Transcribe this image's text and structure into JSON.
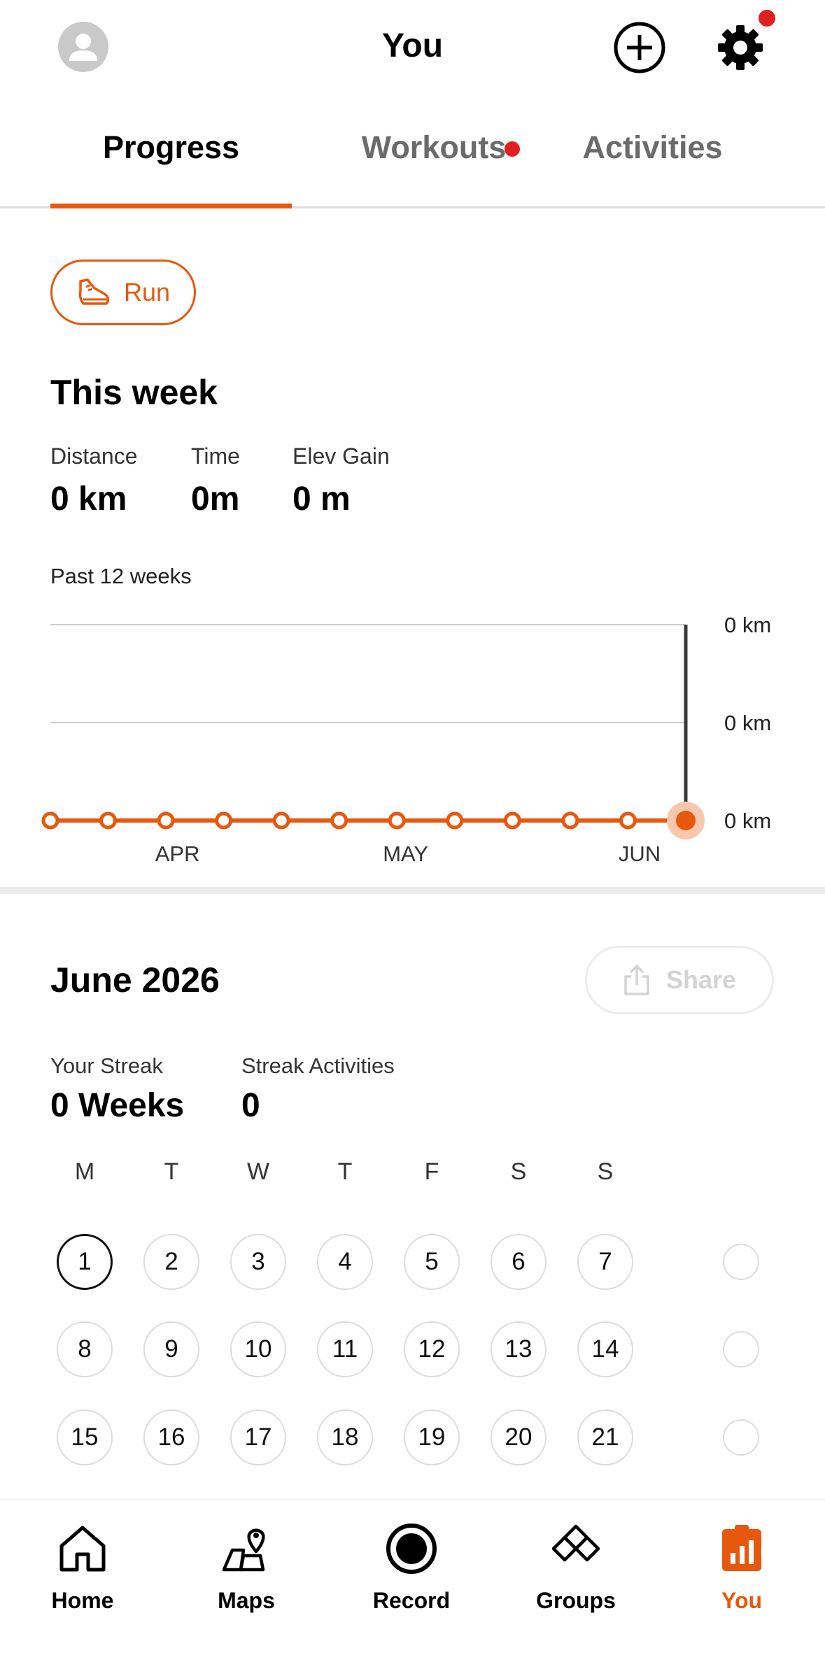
{
  "header": {
    "title": "You",
    "avatar_icon": "user-avatar-icon",
    "add_icon": "plus-circle-icon",
    "settings_icon": "gear-icon"
  },
  "tabs": [
    {
      "label": "Progress",
      "active": true
    },
    {
      "label": "Workouts",
      "active": false,
      "has_dot": true
    },
    {
      "label": "Activities",
      "active": false
    }
  ],
  "sport_filter": {
    "label": "Run",
    "icon": "running-shoe-icon"
  },
  "this_week": {
    "title": "This week",
    "stats": [
      {
        "label": "Distance",
        "value": "0 km"
      },
      {
        "label": "Time",
        "value": "0m"
      },
      {
        "label": "Elev Gain",
        "value": "0 m"
      }
    ]
  },
  "chart_data": {
    "type": "line",
    "subtitle": "Past 12 weeks",
    "x": [
      1,
      2,
      3,
      4,
      5,
      6,
      7,
      8,
      9,
      10,
      11,
      12
    ],
    "month_labels": [
      "APR",
      "MAY",
      "JUN"
    ],
    "ytick_labels": [
      "0 km",
      "0 km",
      "0 km"
    ],
    "series": [
      {
        "values": [
          0,
          0,
          0,
          0,
          0,
          0,
          0,
          0,
          0,
          0,
          0,
          0
        ]
      }
    ],
    "selected_index": 11,
    "grid": true
  },
  "month": {
    "title": "June 2026",
    "share_label": "Share",
    "streak_label": "Your Streak",
    "streak_value": "0 Weeks",
    "streak_activities_label": "Streak Activities",
    "streak_activities_value": "0",
    "weekdays": [
      "M",
      "T",
      "W",
      "T",
      "F",
      "S",
      "S"
    ],
    "weeks": [
      [
        "1",
        "2",
        "3",
        "4",
        "5",
        "6",
        "7"
      ],
      [
        "8",
        "9",
        "10",
        "11",
        "12",
        "13",
        "14"
      ],
      [
        "15",
        "16",
        "17",
        "18",
        "19",
        "20",
        "21"
      ]
    ],
    "today": "1"
  },
  "colors": {
    "accent": "#e8580c",
    "notification": "#e02020"
  },
  "bottom_nav": [
    {
      "label": "Home",
      "icon": "home-icon",
      "active": false
    },
    {
      "label": "Maps",
      "icon": "map-icon",
      "active": false
    },
    {
      "label": "Record",
      "icon": "record-icon",
      "active": false
    },
    {
      "label": "Groups",
      "icon": "groups-icon",
      "active": false
    },
    {
      "label": "You",
      "icon": "you-stats-icon",
      "active": true
    }
  ]
}
